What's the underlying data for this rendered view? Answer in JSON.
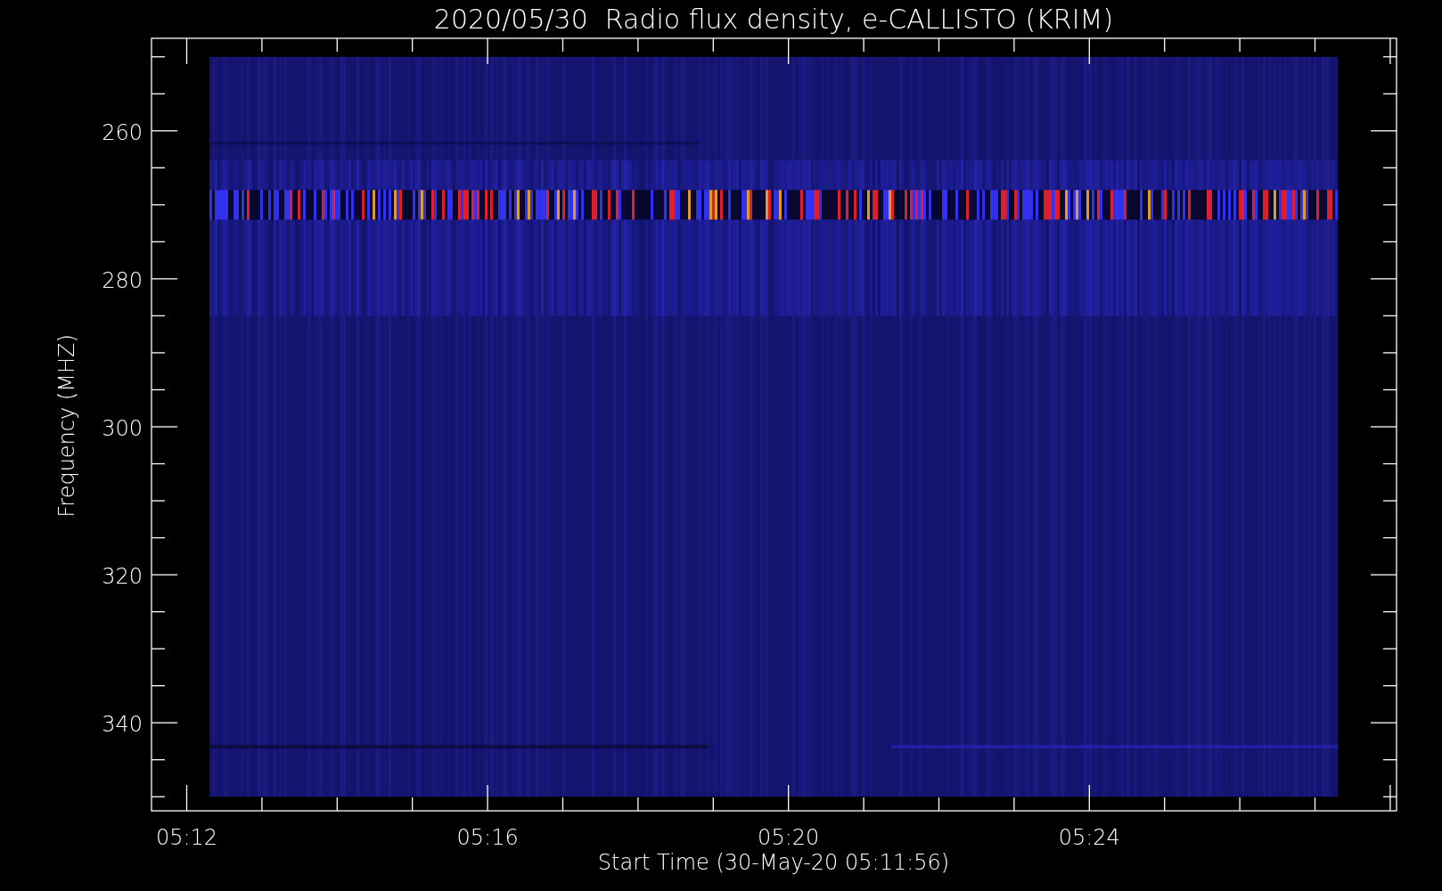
{
  "title": "2020/05/30  Radio flux density, e-CALLISTO (KRIM)",
  "x_axis": {
    "title": "Start Time (30-May-20 05:11:56)",
    "ticks": [
      "05:12",
      "05:16",
      "05:20",
      "05:24"
    ]
  },
  "y_axis": {
    "title": "Frequency (MHZ)",
    "ticks": [
      "260",
      "280",
      "300",
      "320",
      "340"
    ]
  }
}
